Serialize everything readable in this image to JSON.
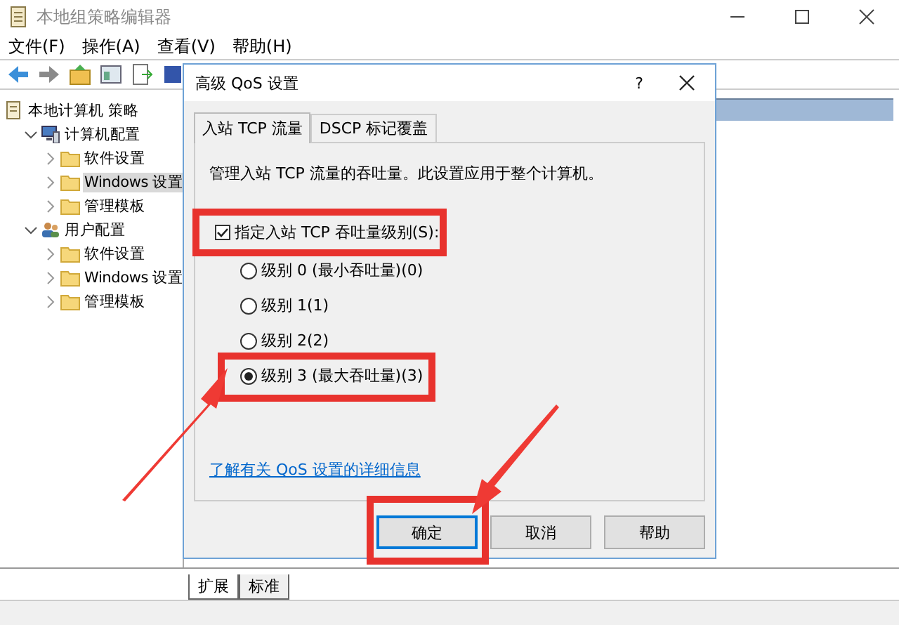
{
  "window": {
    "title": "本地组策略编辑器"
  },
  "menu": [
    "文件(F)",
    "操作(A)",
    "查看(V)",
    "帮助(H)"
  ],
  "tree": [
    {
      "label": "本地计算机 策略",
      "kind": "root",
      "selected": false,
      "children": [
        {
          "label": "计算机配置",
          "kind": "computer",
          "expanded": true,
          "selected": false,
          "children": [
            {
              "label": "软件设置",
              "kind": "folder",
              "expanded": false,
              "selected": false
            },
            {
              "label": "Windows 设置",
              "kind": "folder",
              "expanded": false,
              "selected": true
            },
            {
              "label": "管理模板",
              "kind": "folder",
              "expanded": false,
              "selected": false
            }
          ]
        },
        {
          "label": "用户配置",
          "kind": "users",
          "expanded": true,
          "selected": false,
          "children": [
            {
              "label": "软件设置",
              "kind": "folder",
              "expanded": false,
              "selected": false
            },
            {
              "label": "Windows 设置",
              "kind": "folder",
              "expanded": false,
              "selected": false
            },
            {
              "label": "管理模板",
              "kind": "folder",
              "expanded": false,
              "selected": false
            }
          ]
        }
      ]
    }
  ],
  "bottom_tabs": [
    {
      "label": "扩展",
      "selected": true
    },
    {
      "label": "标准",
      "selected": false
    }
  ],
  "dialog": {
    "title": "高级 QoS 设置",
    "help": "?",
    "tabs": [
      {
        "label": "入站 TCP 流量",
        "selected": true
      },
      {
        "label": "DSCP 标记覆盖",
        "selected": false
      }
    ],
    "description": "管理入站 TCP 流量的吞吐量。此设置应用于整个计算机。",
    "checkbox": {
      "label": "指定入站 TCP 吞吐量级别(S):",
      "checked": true
    },
    "radios": [
      {
        "label": "级别 0 (最小吞吐量)(0)",
        "selected": false
      },
      {
        "label": "级别 1(1)",
        "selected": false
      },
      {
        "label": "级别 2(2)",
        "selected": false
      },
      {
        "label": "级别 3 (最大吞吐量)(3)",
        "selected": true
      }
    ],
    "link": "了解有关 QoS 设置的详细信息",
    "buttons": [
      {
        "label": "确定",
        "default": true
      },
      {
        "label": "取消",
        "default": false
      },
      {
        "label": "帮助",
        "default": false
      }
    ]
  }
}
